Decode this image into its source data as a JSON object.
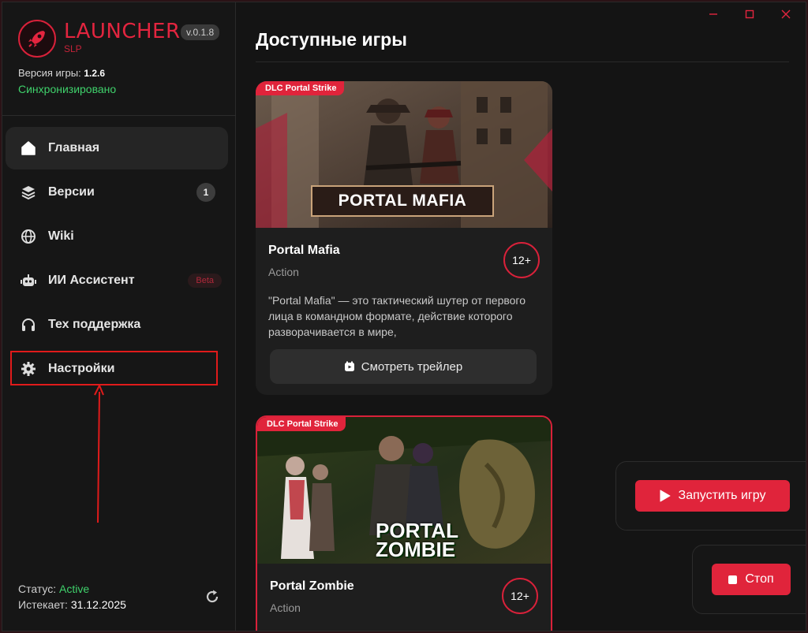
{
  "app": {
    "logo_title": "LAUNCHER",
    "logo_sub": "SLP",
    "version": "v.0.1.8",
    "game_version_label": "Версия игры:",
    "game_version_value": "1.2.6",
    "sync_status": "Синхронизировано"
  },
  "sidebar": {
    "items": [
      {
        "label": "Главная",
        "icon": "home-icon",
        "active": true
      },
      {
        "label": "Версии",
        "icon": "layers-icon",
        "badge": "1"
      },
      {
        "label": "Wiki",
        "icon": "globe-icon"
      },
      {
        "label": "ИИ Ассистент",
        "icon": "robot-icon",
        "tag": "Beta"
      },
      {
        "label": "Тех поддержка",
        "icon": "headphones-icon"
      },
      {
        "label": "Настройки",
        "icon": "gear-icon"
      }
    ],
    "footer": {
      "status_label": "Статус:",
      "status_value": "Active",
      "expires_label": "Истекает:",
      "expires_value": "31.12.2025"
    }
  },
  "main": {
    "title": "Доступные игры",
    "cards": [
      {
        "tag": "DLC Portal Strike",
        "hero_title": "PORTAL MAFIA",
        "name": "Portal Mafia",
        "genre": "Action",
        "age": "12+",
        "description": "\"Portal Mafia\" — это тактический шутер от первого лица в командном формате, действие которого разворачивается в мире,",
        "trailer_label": "Смотреть трейлер"
      },
      {
        "tag": "DLC Portal Strike",
        "hero_title_line1": "PORTAL",
        "hero_title_line2": "ZOMBIE",
        "name": "Portal Zombie",
        "genre": "Action",
        "age": "12+"
      }
    ],
    "launch_label": "Запустить игру",
    "stop_label": "Стоп"
  },
  "colors": {
    "accent": "#e0243b",
    "success": "#3fd16b",
    "background": "#141414",
    "highlight": "#e01b1b"
  }
}
